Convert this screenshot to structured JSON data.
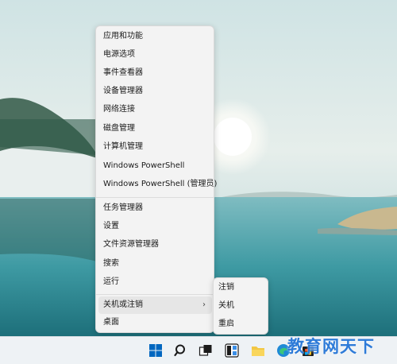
{
  "context_menu": {
    "items": [
      {
        "label": "应用和功能"
      },
      {
        "label": "电源选项"
      },
      {
        "label": "事件查看器"
      },
      {
        "label": "设备管理器"
      },
      {
        "label": "网络连接"
      },
      {
        "label": "磁盘管理"
      },
      {
        "label": "计算机管理"
      },
      {
        "label": "Windows PowerShell"
      },
      {
        "label": "Windows PowerShell (管理员)"
      },
      {
        "label": "任务管理器"
      },
      {
        "label": "设置"
      },
      {
        "label": "文件资源管理器"
      },
      {
        "label": "搜索"
      },
      {
        "label": "运行"
      },
      {
        "label": "关机或注销"
      },
      {
        "label": "桌面"
      }
    ]
  },
  "submenu": {
    "items": [
      {
        "label": "注销"
      },
      {
        "label": "关机"
      },
      {
        "label": "重启"
      }
    ]
  },
  "taskbar": {
    "icons": [
      "start-icon",
      "search-icon",
      "task-view-icon",
      "widgets-icon",
      "file-explorer-icon",
      "edge-icon",
      "store-icon"
    ]
  },
  "watermark": {
    "text": "教育网天下"
  },
  "colors": {
    "accent": "#0067c0",
    "menu_bg": "#f3f3f3",
    "taskbar_bg": "#eef2f5"
  }
}
